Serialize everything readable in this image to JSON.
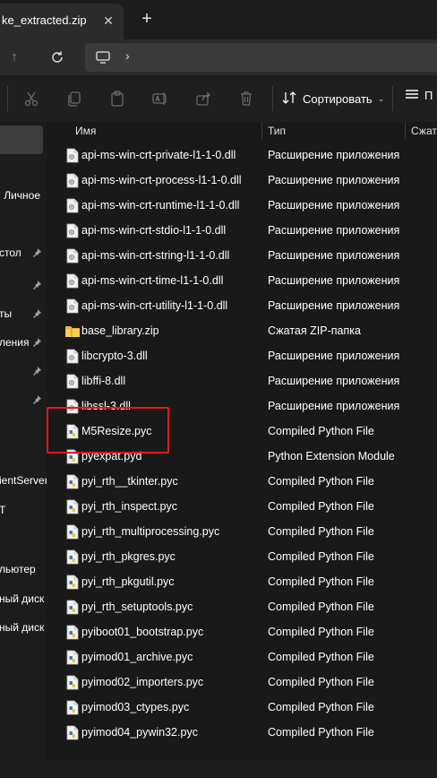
{
  "tab": {
    "title": "ke_extracted.zip",
    "close_icon": "close-icon",
    "new_tab_icon": "plus-icon"
  },
  "toolbar": {
    "sort_label": "Сортировать",
    "view_label": "П",
    "icons": [
      "cut-icon",
      "copy-icon",
      "paste-icon",
      "rename-icon",
      "share-icon",
      "delete-icon",
      "sort-icon",
      "view-icon"
    ]
  },
  "columns": {
    "name": "Имя",
    "type": "Тип",
    "size": "Сжат"
  },
  "nav": {
    "items": [
      "Личное",
      "стол",
      "ты",
      "ления",
      "ientServer",
      "T",
      "льютер",
      "ный диск",
      "ный диск"
    ]
  },
  "files": [
    {
      "name": "api-ms-win-crt-private-l1-1-0.dll",
      "type": "Расширение приложения",
      "icon": "dll-icon"
    },
    {
      "name": "api-ms-win-crt-process-l1-1-0.dll",
      "type": "Расширение приложения",
      "icon": "dll-icon"
    },
    {
      "name": "api-ms-win-crt-runtime-l1-1-0.dll",
      "type": "Расширение приложения",
      "icon": "dll-icon"
    },
    {
      "name": "api-ms-win-crt-stdio-l1-1-0.dll",
      "type": "Расширение приложения",
      "icon": "dll-icon"
    },
    {
      "name": "api-ms-win-crt-string-l1-1-0.dll",
      "type": "Расширение приложения",
      "icon": "dll-icon"
    },
    {
      "name": "api-ms-win-crt-time-l1-1-0.dll",
      "type": "Расширение приложения",
      "icon": "dll-icon"
    },
    {
      "name": "api-ms-win-crt-utility-l1-1-0.dll",
      "type": "Расширение приложения",
      "icon": "dll-icon"
    },
    {
      "name": "base_library.zip",
      "type": "Сжатая ZIP-папка",
      "icon": "zip-folder-icon"
    },
    {
      "name": "libcrypto-3.dll",
      "type": "Расширение приложения",
      "icon": "dll-icon"
    },
    {
      "name": "libffi-8.dll",
      "type": "Расширение приложения",
      "icon": "dll-icon"
    },
    {
      "name": "libssl-3.dll",
      "type": "Расширение приложения",
      "icon": "dll-icon"
    },
    {
      "name": "M5Resize.pyc",
      "type": "Compiled Python File",
      "icon": "python-file-icon"
    },
    {
      "name": "pyexpat.pyd",
      "type": "Python Extension Module",
      "icon": "python-file-icon"
    },
    {
      "name": "pyi_rth__tkinter.pyc",
      "type": "Compiled Python File",
      "icon": "python-file-icon"
    },
    {
      "name": "pyi_rth_inspect.pyc",
      "type": "Compiled Python File",
      "icon": "python-file-icon"
    },
    {
      "name": "pyi_rth_multiprocessing.pyc",
      "type": "Compiled Python File",
      "icon": "python-file-icon"
    },
    {
      "name": "pyi_rth_pkgres.pyc",
      "type": "Compiled Python File",
      "icon": "python-file-icon"
    },
    {
      "name": "pyi_rth_pkgutil.pyc",
      "type": "Compiled Python File",
      "icon": "python-file-icon"
    },
    {
      "name": "pyi_rth_setuptools.pyc",
      "type": "Compiled Python File",
      "icon": "python-file-icon"
    },
    {
      "name": "pyiboot01_bootstrap.pyc",
      "type": "Compiled Python File",
      "icon": "python-file-icon"
    },
    {
      "name": "pyimod01_archive.pyc",
      "type": "Compiled Python File",
      "icon": "python-file-icon"
    },
    {
      "name": "pyimod02_importers.pyc",
      "type": "Compiled Python File",
      "icon": "python-file-icon"
    },
    {
      "name": "pyimod03_ctypes.pyc",
      "type": "Compiled Python File",
      "icon": "python-file-icon"
    },
    {
      "name": "pyimod04_pywin32.pyc",
      "type": "Compiled Python File",
      "icon": "python-file-icon"
    }
  ],
  "colors": {
    "highlight_box": "#e8141c",
    "background": "#191919",
    "text": "#ffffff"
  }
}
